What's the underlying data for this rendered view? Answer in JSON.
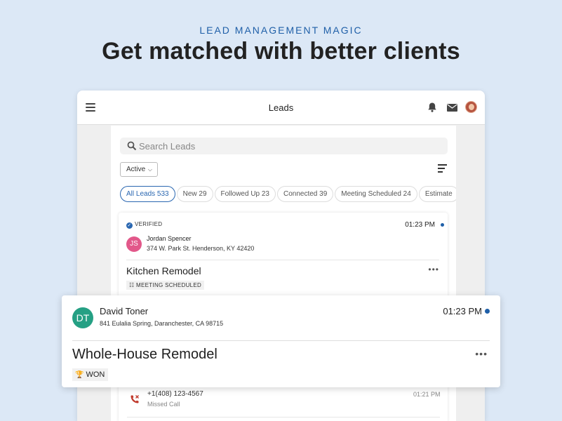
{
  "hero": {
    "eyebrow": "LEAD MANAGEMENT MAGIC",
    "headline": "Get matched with better clients"
  },
  "topbar": {
    "title": "Leads",
    "icons": [
      "menu-icon",
      "bell-icon",
      "mail-icon",
      "user-avatar"
    ]
  },
  "search": {
    "placeholder": "Search Leads"
  },
  "filter": {
    "selected": "Active"
  },
  "chips": [
    {
      "label": "All Leads 533",
      "selected": true
    },
    {
      "label": "New 29",
      "selected": false
    },
    {
      "label": "Followed Up 23",
      "selected": false
    },
    {
      "label": "Connected 39",
      "selected": false
    },
    {
      "label": "Meeting Scheduled 24",
      "selected": false
    },
    {
      "label": "Estimate",
      "selected": false
    }
  ],
  "lead1": {
    "badge": "VERIFIED",
    "time": "01:23 PM",
    "initials": "JS",
    "name": "Jordan Spencer",
    "address": "374 W. Park St. Henderson, KY 42420",
    "project": "Kitchen Remodel",
    "status": "MEETING SCHEDULED",
    "more": "•••"
  },
  "call": {
    "number": "+1(408) 123-4567",
    "label": "Missed Call",
    "time": "01:21 PM"
  },
  "lead2": {
    "initials": "DT",
    "name": "David Toner",
    "address": "841 Eulalia Spring, Daranchester, CA 98715",
    "time": "01:23 PM",
    "project": "Whole-House Remodel",
    "status": "WON",
    "more": "•••"
  },
  "colors": {
    "background": "#dce8f6",
    "accent": "#1f5fa8",
    "avatar_js": "#e2588a",
    "avatar_dt": "#25a084"
  }
}
